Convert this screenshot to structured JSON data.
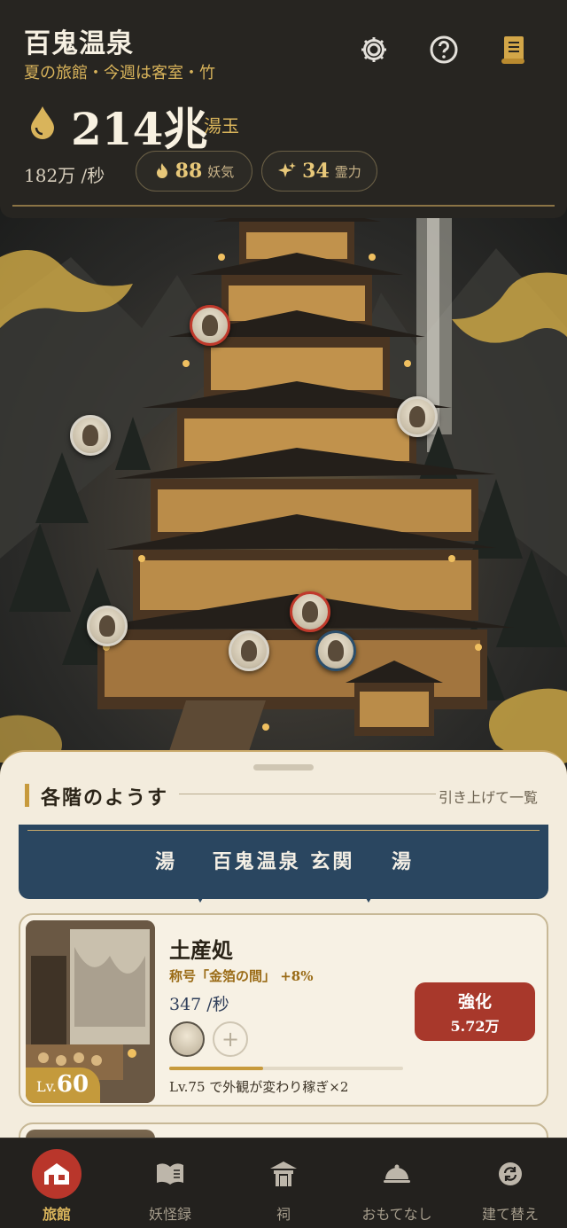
{
  "header": {
    "title": "百鬼温泉",
    "subtitle": "夏の旅館・今週は客室・竹",
    "icons": [
      "gear-icon",
      "help-icon",
      "scroll-icon"
    ],
    "currency": {
      "amount": "214兆",
      "unit": "湯玉",
      "rate": "182万 /秒"
    },
    "pills": [
      {
        "value": "88",
        "label": "妖気",
        "icon": "flame-icon"
      },
      {
        "value": "34",
        "label": "霊力",
        "icon": "sparkle-icon"
      }
    ]
  },
  "panel": {
    "section_title": "各階のようす",
    "section_hint": "引き上げて一覧",
    "banner": {
      "left": "湯",
      "center": "百鬼温泉 玄関",
      "right": "湯"
    },
    "card": {
      "level_prefix": "Lv.",
      "level": "60",
      "title": "土産処",
      "subtitle": "称号「金箔の間」 +8%",
      "rate": "347 /秒",
      "add_symbol": "+",
      "progress": 0.4,
      "note": "Lv.75 で外観が変わり稼ぎ×2",
      "upgrade_label": "強化",
      "upgrade_cost": "5.72万"
    }
  },
  "nav": [
    {
      "label": "旅館",
      "icon": "inn-icon",
      "active": true
    },
    {
      "label": "妖怪録",
      "icon": "book-icon",
      "active": false
    },
    {
      "label": "祠",
      "icon": "shrine-icon",
      "active": false
    },
    {
      "label": "おもてなし",
      "icon": "cloche-icon",
      "active": false
    },
    {
      "label": "建て替え",
      "icon": "rebuild-icon",
      "active": false
    }
  ],
  "colors": {
    "accent_gold": "#d9b45b",
    "banner_navy": "#2a4660",
    "button_red": "#a8382b"
  }
}
